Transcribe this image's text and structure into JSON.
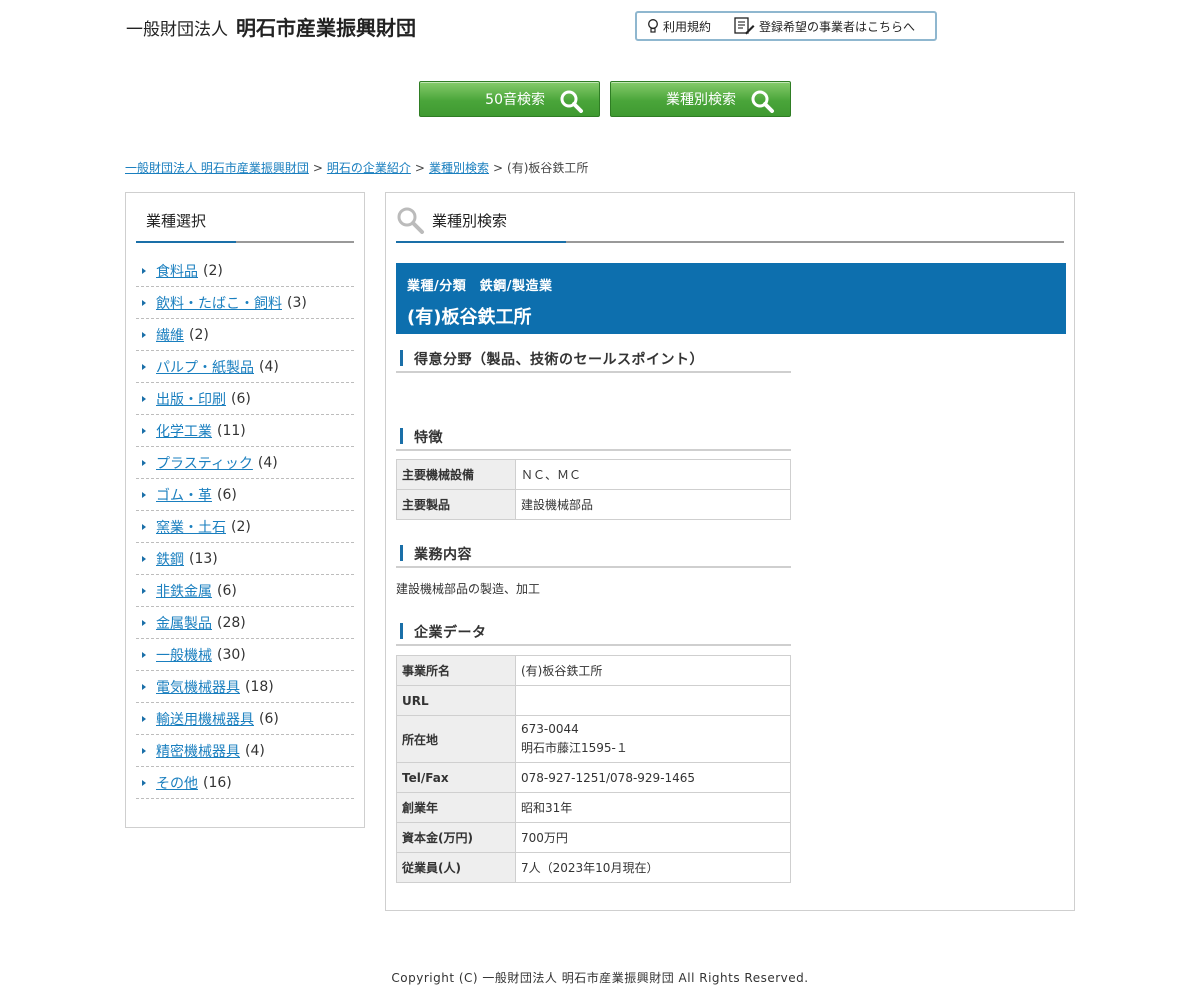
{
  "header": {
    "org_type": "一般財団法人",
    "org_name": "明石市産業振興財団",
    "link_terms": "利用規約",
    "link_register": "登録希望の事業者はこちらへ"
  },
  "search_buttons": {
    "kana": "50音検索",
    "industry": "業種別検索"
  },
  "breadcrumb": {
    "items": [
      "一般財団法人 明石市産業振興財団",
      "明石の企業紹介",
      "業種別検索"
    ],
    "current": "(有)板谷鉄工所",
    "separator": ">"
  },
  "sidebar": {
    "title": "業種選択",
    "items": [
      {
        "label": "食料品",
        "count": "(2)"
      },
      {
        "label": "飲料・たばこ・飼料",
        "count": "(3)"
      },
      {
        "label": "繊維",
        "count": "(2)"
      },
      {
        "label": "パルプ・紙製品",
        "count": "(4)"
      },
      {
        "label": "出版・印刷",
        "count": "(6)"
      },
      {
        "label": "化学工業",
        "count": "(11)"
      },
      {
        "label": "プラスティック",
        "count": "(4)"
      },
      {
        "label": "ゴム・革",
        "count": "(6)"
      },
      {
        "label": "窯業・土石",
        "count": "(2)"
      },
      {
        "label": "鉄鋼",
        "count": "(13)"
      },
      {
        "label": "非鉄金属",
        "count": "(6)"
      },
      {
        "label": "金属製品",
        "count": "(28)"
      },
      {
        "label": "一般機械",
        "count": "(30)"
      },
      {
        "label": "電気機械器具",
        "count": "(18)"
      },
      {
        "label": "輸送用機械器具",
        "count": "(6)"
      },
      {
        "label": "精密機械器具",
        "count": "(4)"
      },
      {
        "label": "その他",
        "count": "(16)"
      }
    ]
  },
  "main": {
    "title": "業種別検索",
    "classification": "業種/分類　鉄鋼/製造業",
    "company_name": "(有)板谷鉄工所",
    "section_strength": "得意分野（製品、技術のセールスポイント）",
    "section_features": "特徴",
    "features": [
      {
        "label": "主要機械設備",
        "value": "ＮＣ、ＭＣ"
      },
      {
        "label": "主要製品",
        "value": "建設機械部品"
      }
    ],
    "section_business": "業務内容",
    "business_text": "建設機械部品の製造、加工",
    "section_company": "企業データ",
    "company_data": {
      "office_label": "事業所名",
      "office_value": "(有)板谷鉄工所",
      "url_label": "URL",
      "url_value": "",
      "address_label": "所在地",
      "address_zip": "673-0044",
      "address_value": "明石市藤江1595-１",
      "tel_label": "Tel/Fax",
      "tel_value": "078-927-1251/078-929-1465",
      "founded_label": "創業年",
      "founded_value": "昭和31年",
      "capital_label": "資本金(万円)",
      "capital_value": "700万円",
      "employees_label": "従業員(人)",
      "employees_value": "7人（2023年10月現在）"
    }
  },
  "footer": {
    "copyright": "Copyright (C) 一般財団法人 明石市産業振興財団 All Rights Reserved."
  },
  "colors": {
    "brand_blue": "#0d6fae",
    "button_green": "#4aa53a",
    "link": "#1a7fbf"
  }
}
